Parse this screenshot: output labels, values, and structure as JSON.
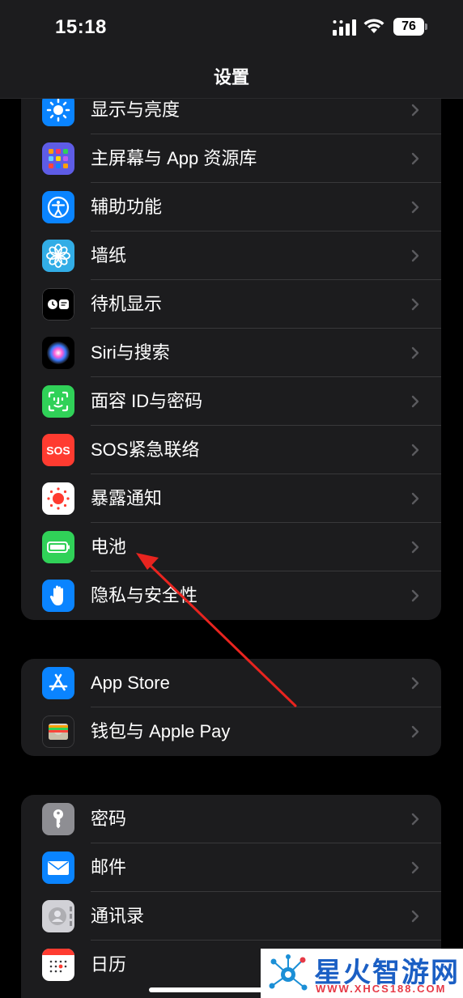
{
  "status_bar": {
    "time": "15:18",
    "battery_level": "76"
  },
  "nav": {
    "title": "设置"
  },
  "groups": [
    {
      "items": [
        {
          "label": "显示与亮度",
          "icon": "sun-icon"
        },
        {
          "label": "主屏幕与 App 资源库",
          "icon": "home-screen-icon"
        },
        {
          "label": "辅助功能",
          "icon": "accessibility-icon"
        },
        {
          "label": "墙纸",
          "icon": "wallpaper-flower-icon"
        },
        {
          "label": "待机显示",
          "icon": "standby-icon"
        },
        {
          "label": "Siri与搜索",
          "icon": "siri-icon"
        },
        {
          "label": "面容 ID与密码",
          "icon": "face-id-icon"
        },
        {
          "label": "SOS紧急联络",
          "icon": "sos-icon"
        },
        {
          "label": "暴露通知",
          "icon": "exposure-notification-icon"
        },
        {
          "label": "电池",
          "icon": "battery-icon"
        },
        {
          "label": "隐私与安全性",
          "icon": "privacy-hand-icon"
        }
      ]
    },
    {
      "items": [
        {
          "label": "App Store",
          "icon": "app-store-icon"
        },
        {
          "label": "钱包与 Apple Pay",
          "icon": "wallet-icon"
        }
      ]
    },
    {
      "items": [
        {
          "label": "密码",
          "icon": "key-icon"
        },
        {
          "label": "邮件",
          "icon": "mail-icon"
        },
        {
          "label": "通讯录",
          "icon": "contacts-icon"
        },
        {
          "label": "日历",
          "icon": "calendar-icon"
        }
      ]
    }
  ],
  "icon_colors": {
    "sun-icon": "#0a84ff",
    "home-screen-icon": "#5e5ce6",
    "accessibility-icon": "#0a84ff",
    "wallpaper-flower-icon": "#32ade6",
    "standby-icon": "#000000",
    "siri-icon": "#000000",
    "face-id-icon": "#30d158",
    "sos-icon": "#ff3b30",
    "exposure-notification-icon": "#ffffff",
    "battery-icon": "#30d158",
    "privacy-hand-icon": "#0a84ff",
    "app-store-icon": "#0a84ff",
    "wallet-icon": "#1c1c1e",
    "key-icon": "#8e8e93",
    "mail-icon": "#0a84ff",
    "contacts-icon": "#d1d1d6",
    "calendar-icon": "#ffffff"
  },
  "annotation": {
    "arrow_color": "#e8241f"
  },
  "watermark": {
    "name": "星火智游网",
    "url": "WWW.XHCS188.COM"
  }
}
